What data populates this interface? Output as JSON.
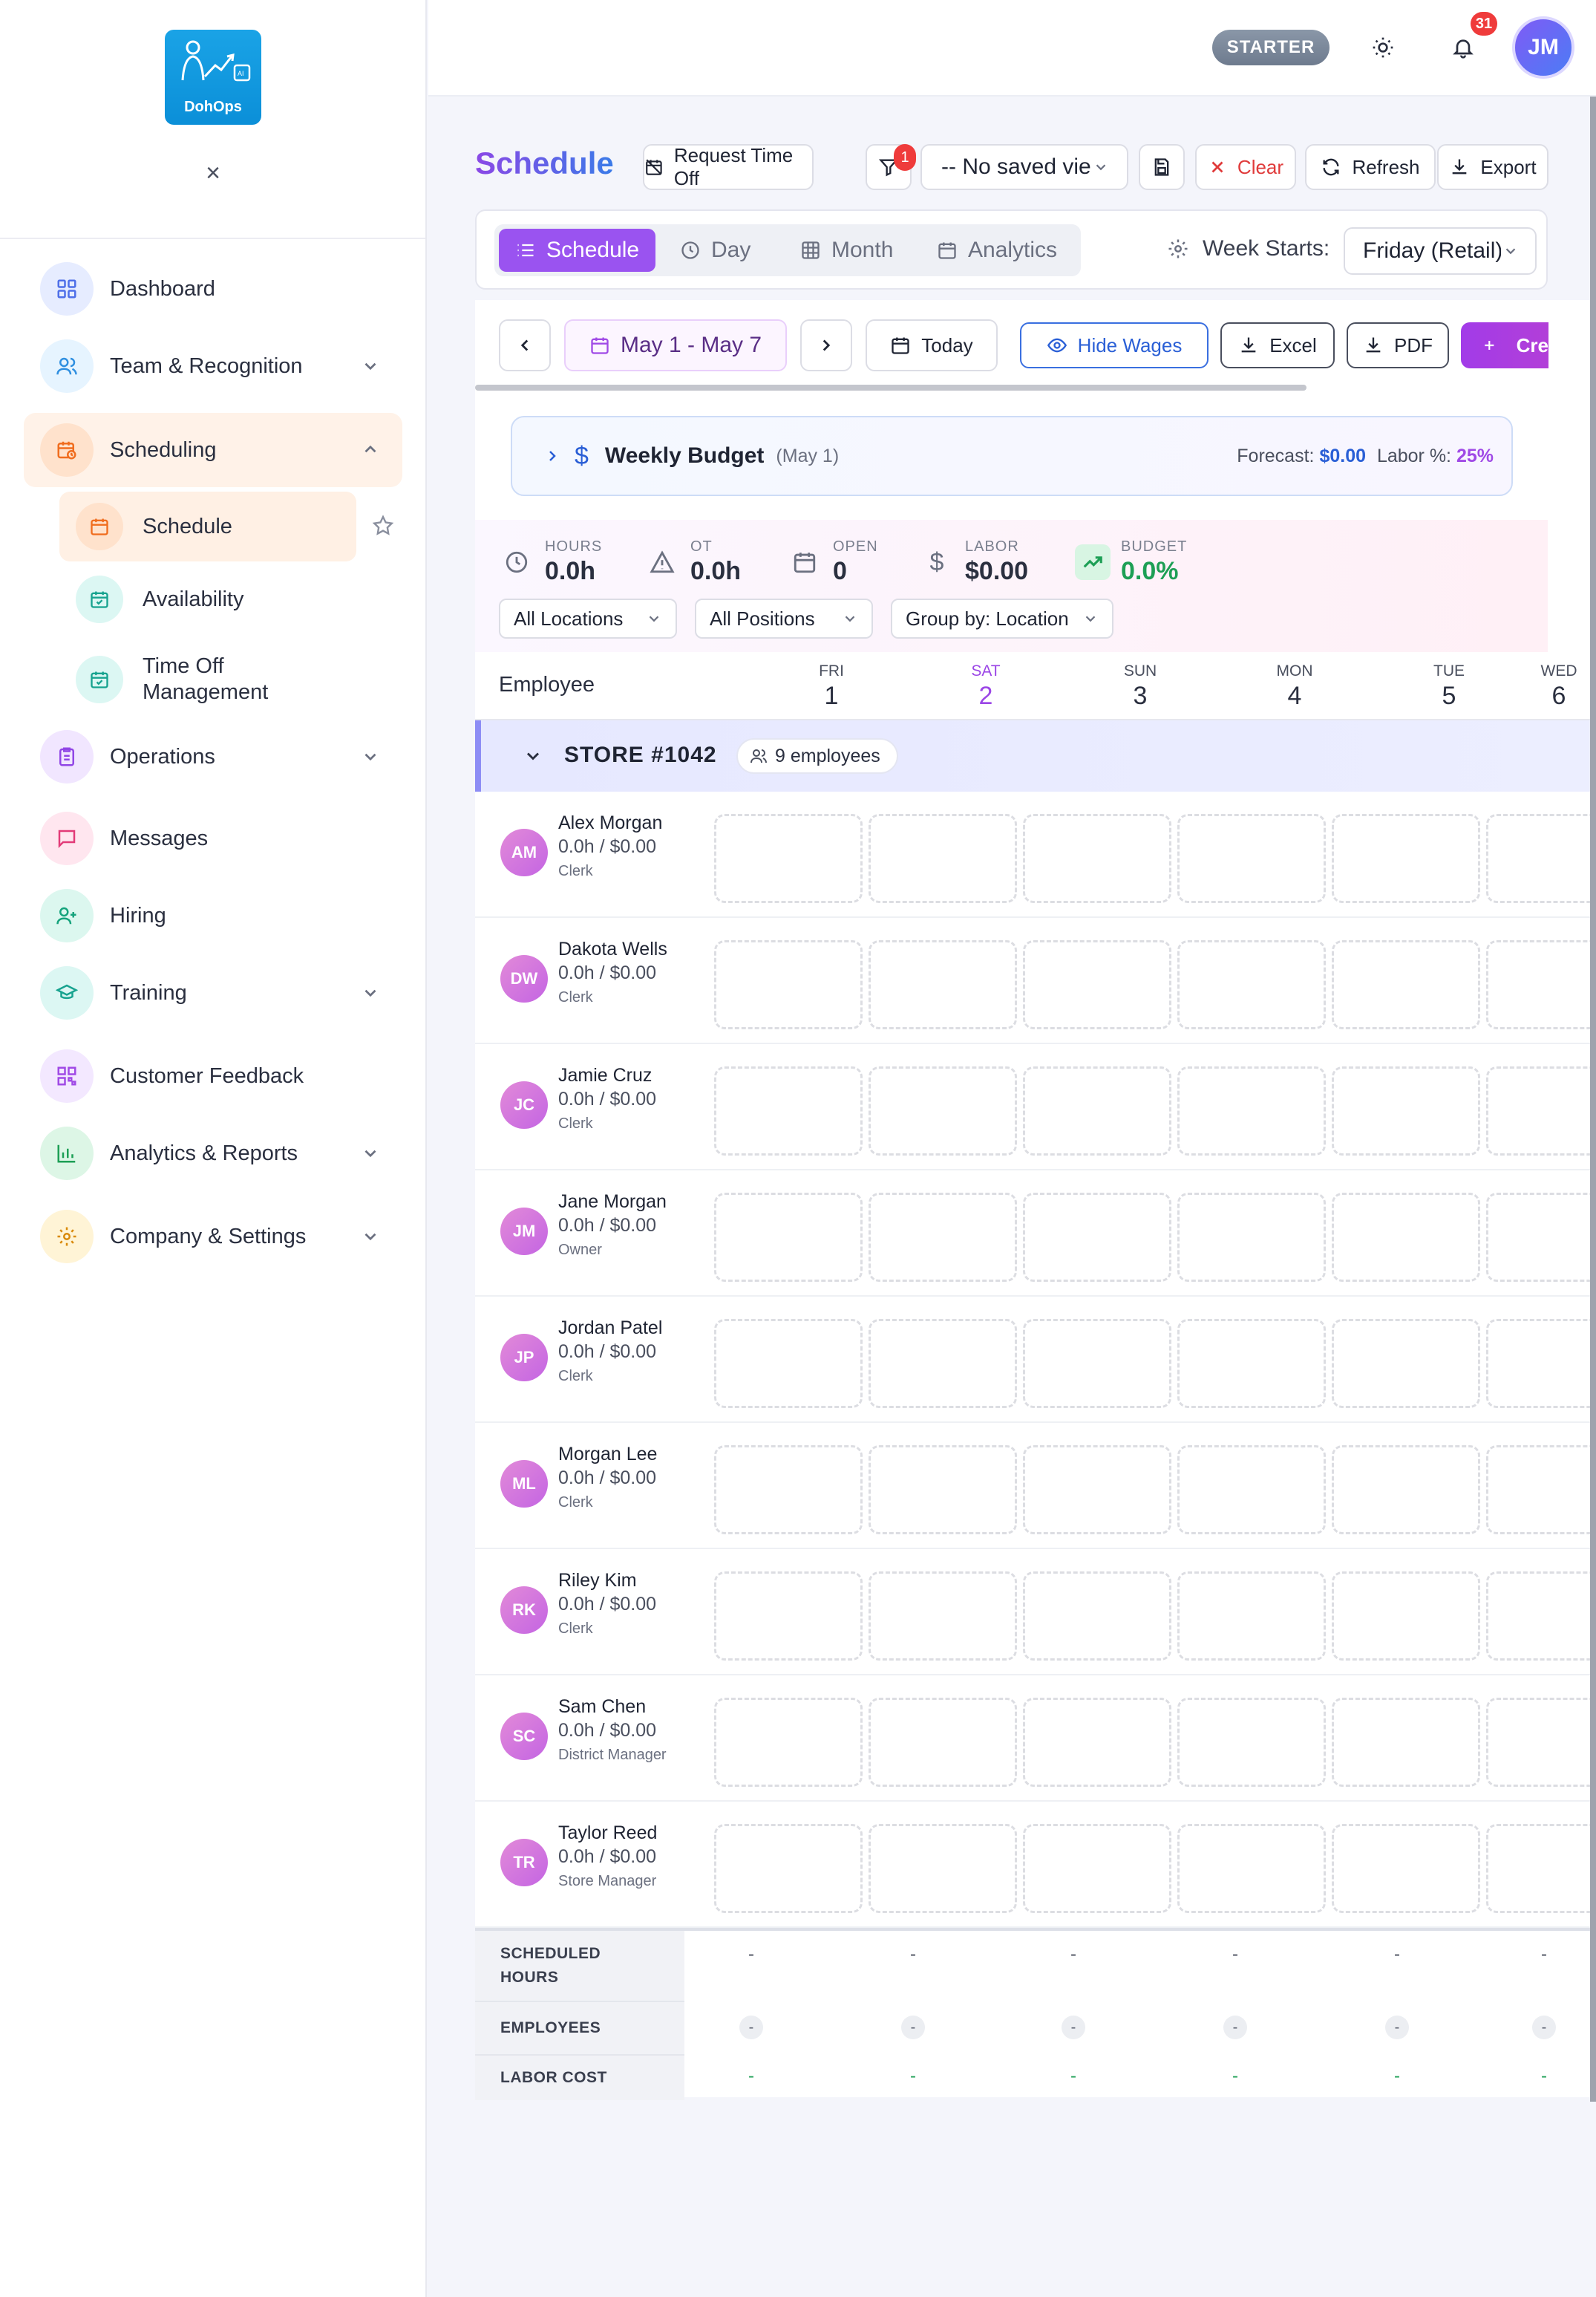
{
  "sidebar": {
    "logo_text": "DohOps",
    "items": [
      {
        "label": "Dashboard",
        "icon": "grid-icon"
      },
      {
        "label": "Team & Recognition",
        "icon": "users-icon"
      },
      {
        "label": "Scheduling",
        "icon": "calendar-clock-icon"
      },
      {
        "label": "Operations",
        "icon": "clipboard-icon"
      },
      {
        "label": "Messages",
        "icon": "message-icon"
      },
      {
        "label": "Hiring",
        "icon": "user-plus-icon"
      },
      {
        "label": "Training",
        "icon": "graduation-cap-icon"
      },
      {
        "label": "Customer Feedback",
        "icon": "qr-code-icon"
      },
      {
        "label": "Analytics & Reports",
        "icon": "bar-chart-icon"
      },
      {
        "label": "Company & Settings",
        "icon": "gear-icon"
      }
    ],
    "sub_items": [
      {
        "label": "Schedule"
      },
      {
        "label": "Availability"
      },
      {
        "label": "Time Off Management"
      }
    ],
    "colors": {
      "accent": "#f97316",
      "active_bg": "#fff2e8"
    }
  },
  "topbar": {
    "plan": "STARTER",
    "notifications": "31",
    "user_initials": "JM"
  },
  "header": {
    "title": "Schedule",
    "request_time_off": "Request Time Off",
    "filter_count": "1",
    "saved_view": "-- No saved vie",
    "clear": "Clear",
    "refresh": "Refresh",
    "export": "Export"
  },
  "view_tabs": [
    {
      "label": "Schedule"
    },
    {
      "label": "Day"
    },
    {
      "label": "Month"
    },
    {
      "label": "Analytics"
    }
  ],
  "week_starts": {
    "label": "Week Starts:",
    "value": "Friday (Retail)"
  },
  "toolbar": {
    "date_range": "May 1 - May 7",
    "today": "Today",
    "hide_wages": "Hide Wages",
    "excel": "Excel",
    "pdf": "PDF",
    "create": "Cre"
  },
  "budget": {
    "title": "Weekly Budget",
    "period": "(May 1)",
    "forecast_label": "Forecast:",
    "forecast_value": "$0.00",
    "labor_label": "Labor %:",
    "labor_value": "25%"
  },
  "stats": [
    {
      "label": "HOURS",
      "value": "0.0h"
    },
    {
      "label": "OT",
      "value": "0.0h"
    },
    {
      "label": "OPEN",
      "value": "0"
    },
    {
      "label": "LABOR",
      "value": "$0.00"
    },
    {
      "label": "BUDGET",
      "value": "0.0%"
    }
  ],
  "filters": {
    "locations": "All Locations",
    "positions": "All Positions",
    "group_by": "Group by: Location"
  },
  "grid": {
    "employee_header": "Employee",
    "days": [
      {
        "name": "FRI",
        "date": "1"
      },
      {
        "name": "SAT",
        "date": "2"
      },
      {
        "name": "SUN",
        "date": "3"
      },
      {
        "name": "MON",
        "date": "4"
      },
      {
        "name": "TUE",
        "date": "5"
      },
      {
        "name": "WED",
        "date": "6"
      }
    ],
    "store": {
      "name": "STORE #1042",
      "count": "9 employees"
    },
    "employees": [
      {
        "initials": "AM",
        "name": "Alex Morgan",
        "hours": "0.0h / $0.00",
        "role": "Clerk"
      },
      {
        "initials": "DW",
        "name": "Dakota Wells",
        "hours": "0.0h / $0.00",
        "role": "Clerk"
      },
      {
        "initials": "JC",
        "name": "Jamie Cruz",
        "hours": "0.0h / $0.00",
        "role": "Clerk"
      },
      {
        "initials": "JM",
        "name": "Jane Morgan",
        "hours": "0.0h / $0.00",
        "role": "Owner"
      },
      {
        "initials": "JP",
        "name": "Jordan Patel",
        "hours": "0.0h / $0.00",
        "role": "Clerk"
      },
      {
        "initials": "ML",
        "name": "Morgan Lee",
        "hours": "0.0h / $0.00",
        "role": "Clerk"
      },
      {
        "initials": "RK",
        "name": "Riley Kim",
        "hours": "0.0h / $0.00",
        "role": "Clerk"
      },
      {
        "initials": "SC",
        "name": "Sam Chen",
        "hours": "0.0h / $0.00",
        "role": "District Manager"
      },
      {
        "initials": "TR",
        "name": "Taylor Reed",
        "hours": "0.0h / $0.00",
        "role": "Store Manager"
      }
    ]
  },
  "summary": {
    "scheduled_hours_label": "SCHEDULED HOURS",
    "employees_label": "EMPLOYEES",
    "labor_cost_label": "LABOR COST",
    "scheduled_hours": [
      "-",
      "-",
      "-",
      "-",
      "-",
      "-"
    ],
    "employees": [
      "-",
      "-",
      "-",
      "-",
      "-",
      "-"
    ],
    "labor_cost": [
      "-",
      "-",
      "-",
      "-",
      "-",
      "-"
    ]
  }
}
